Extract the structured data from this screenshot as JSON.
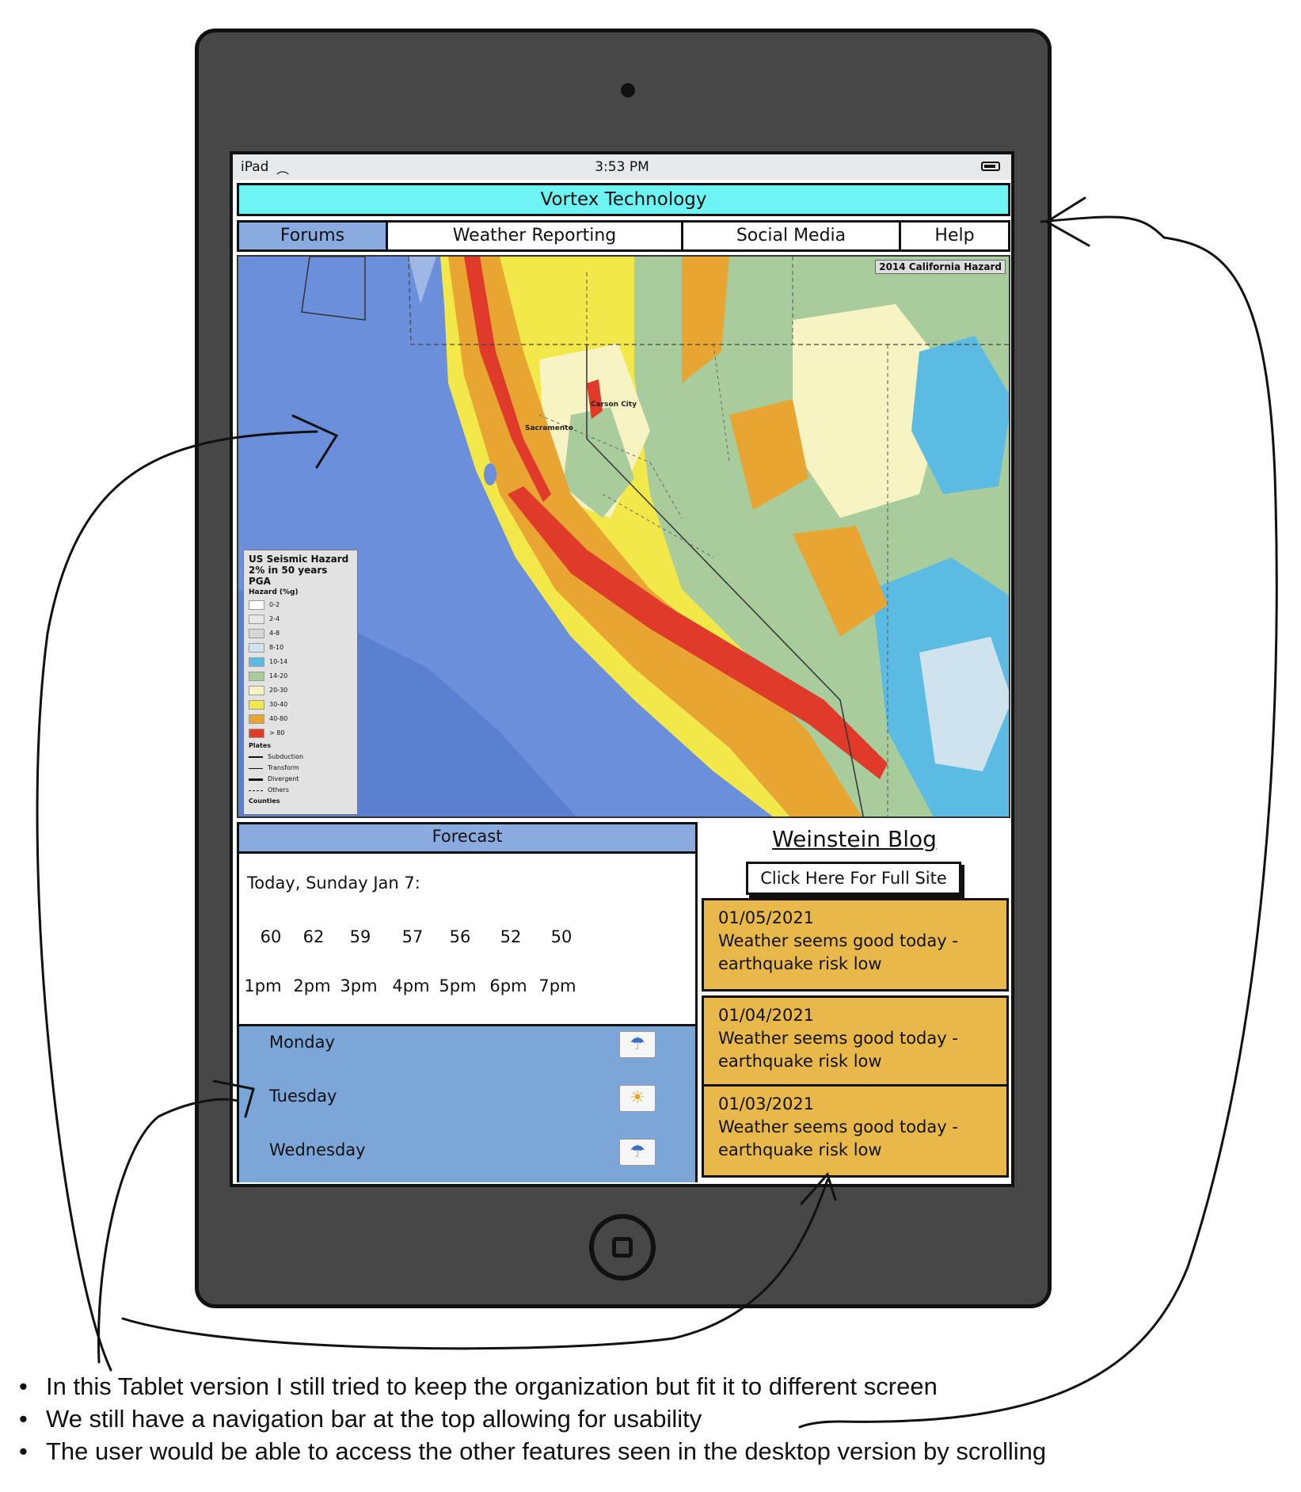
{
  "status_bar": {
    "device": "iPad",
    "time": "3:53 PM"
  },
  "app": {
    "title": "Vortex Technology"
  },
  "nav": {
    "tabs": [
      {
        "label": "Forums",
        "active": true
      },
      {
        "label": "Weather Reporting",
        "active": false
      },
      {
        "label": "Social Media",
        "active": false
      },
      {
        "label": "Help",
        "active": false
      }
    ]
  },
  "map": {
    "credit": "2014 California Hazard",
    "cities": [
      "Carson City",
      "Sacramento"
    ],
    "legend": {
      "title": "US Seismic Hazard",
      "subtitle": "2% in 50 years PGA",
      "scale_label": "Hazard (%g)",
      "items": [
        {
          "label": "0-2",
          "color": "#ffffff"
        },
        {
          "label": "2-4",
          "color": "#e8e8e8"
        },
        {
          "label": "4-8",
          "color": "#d6d6d6"
        },
        {
          "label": "8-10",
          "color": "#cfe3ef"
        },
        {
          "label": "10-14",
          "color": "#5bbbe3"
        },
        {
          "label": "14-20",
          "color": "#a9cc9c"
        },
        {
          "label": "20-30",
          "color": "#f7f3c2"
        },
        {
          "label": "30-40",
          "color": "#f3e84a"
        },
        {
          "label": "40-80",
          "color": "#e9a532"
        },
        {
          "label": "> 80",
          "color": "#e03a2a"
        }
      ],
      "plates_label": "Plates",
      "plates": [
        "Subduction",
        "Transform",
        "Divergent",
        "Others"
      ],
      "counties_label": "Counties"
    }
  },
  "forecast": {
    "header": "Forecast",
    "today_label": "Today, Sunday Jan 7:",
    "temps": [
      "60",
      "62",
      "59",
      "57",
      "56",
      "52",
      "50"
    ],
    "hours": [
      "1pm",
      "2pm",
      "3pm",
      "4pm",
      "5pm",
      "6pm",
      "7pm"
    ],
    "days": [
      {
        "name": "Monday",
        "icon": "rain-cloud-icon",
        "glyph": "☂"
      },
      {
        "name": "Tuesday",
        "icon": "sun-icon",
        "glyph": "☀"
      },
      {
        "name": "Wednesday",
        "icon": "rain-cloud-icon",
        "glyph": "☂"
      }
    ]
  },
  "blog": {
    "title": "Weinstein Blog",
    "full_site_button": "Click Here For Full Site",
    "posts": [
      {
        "date": "01/05/2021",
        "text": "Weather seems good today - earthquake risk low"
      },
      {
        "date": "01/04/2021",
        "text": "Weather seems good today - earthquake risk low"
      },
      {
        "date": "01/03/2021",
        "text": "Weather seems good today - earthquake risk low"
      }
    ]
  },
  "notes": [
    "In this Tablet version I still tried to keep the organization but fit it to different screen",
    "We still have a navigation bar at the top allowing for usability",
    "The user would be able to access the other features seen in the desktop version by scrolling"
  ],
  "colors": {
    "title_bar": "#6ff4f4",
    "nav_active": "#8aabdf",
    "forecast_days_bg": "#7da6d8",
    "blog_post_bg": "#e8b94a",
    "frame": "#474747"
  }
}
